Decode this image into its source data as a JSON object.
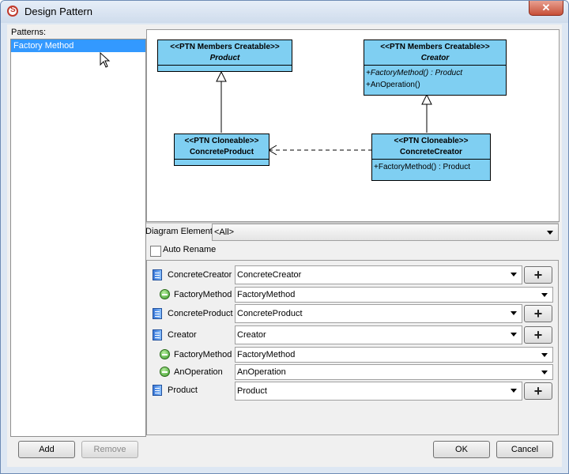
{
  "window": {
    "title": "Design Pattern",
    "close_glyph": "✕"
  },
  "patterns": {
    "label": "Patterns:",
    "items": [
      "Factory Method"
    ]
  },
  "diagram": {
    "product": {
      "stereotype": "<<PTN Members Creatable>>",
      "name": "Product"
    },
    "creator": {
      "stereotype": "<<PTN Members Creatable>>",
      "name": "Creator",
      "ops": [
        "+FactoryMethod() : Product",
        "+AnOperation()"
      ]
    },
    "concrete_product": {
      "stereotype": "<<PTN Cloneable>>",
      "name": "ConcreteProduct"
    },
    "concrete_creator": {
      "stereotype": "<<PTN Cloneable>>",
      "name": "ConcreteCreator",
      "ops": [
        "+FactoryMethod() : Product"
      ]
    }
  },
  "diagram_element": {
    "label": "Diagram Element",
    "value": "<All>"
  },
  "auto_rename": {
    "label": "Auto Rename",
    "checked": false
  },
  "params": [
    {
      "label": "ConcreteCreator",
      "value": "ConcreteCreator",
      "icon": "class-icon"
    },
    {
      "label": "FactoryMethod",
      "value": "FactoryMethod",
      "icon": "operation-icon"
    },
    {
      "label": "ConcreteProduct",
      "value": "ConcreteProduct",
      "icon": "class-icon"
    },
    {
      "label": "Creator",
      "value": "Creator",
      "icon": "class-icon"
    },
    {
      "label": "FactoryMethod",
      "value": "FactoryMethod",
      "icon": "operation-icon"
    },
    {
      "label": "AnOperation",
      "value": "AnOperation",
      "icon": "operation-icon"
    },
    {
      "label": "Product",
      "value": "Product",
      "icon": "class-icon"
    }
  ],
  "plus_glyph": "+",
  "buttons": {
    "add": "Add",
    "remove": "Remove",
    "ok": "OK",
    "cancel": "Cancel"
  }
}
